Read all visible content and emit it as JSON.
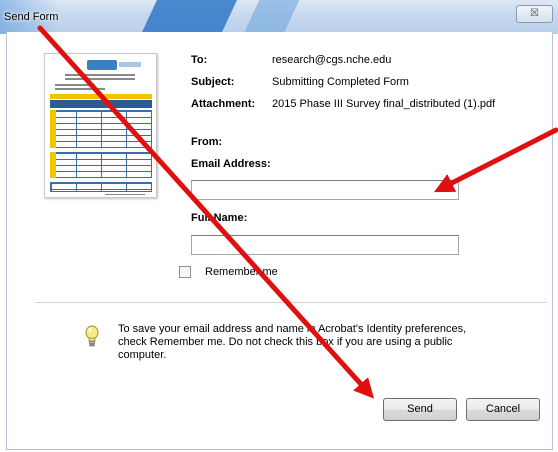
{
  "window": {
    "title": "Send Form",
    "close_glyph": "☒"
  },
  "form": {
    "to_label": "To:",
    "to_value": "research@cgs.nche.edu",
    "subject_label": "Subject:",
    "subject_value": "Submitting Completed Form",
    "attachment_label": "Attachment:",
    "attachment_value": "2015 Phase III Survey final_distributed (1).pdf",
    "from_label": "From:",
    "email_label": "Email Address:",
    "email_value": "",
    "fullname_label": "Full Name:",
    "fullname_value": "",
    "remember_label": "Remember me",
    "remember_checked": false
  },
  "tip": {
    "icon": "lightbulb-icon",
    "text": "To save your email address and name in Acrobat's Identity preferences, check Remember me. Do not check this box if you are using a public computer."
  },
  "buttons": {
    "send": "Send",
    "cancel": "Cancel"
  },
  "annotations": {
    "arrow_color": "#e01010"
  }
}
